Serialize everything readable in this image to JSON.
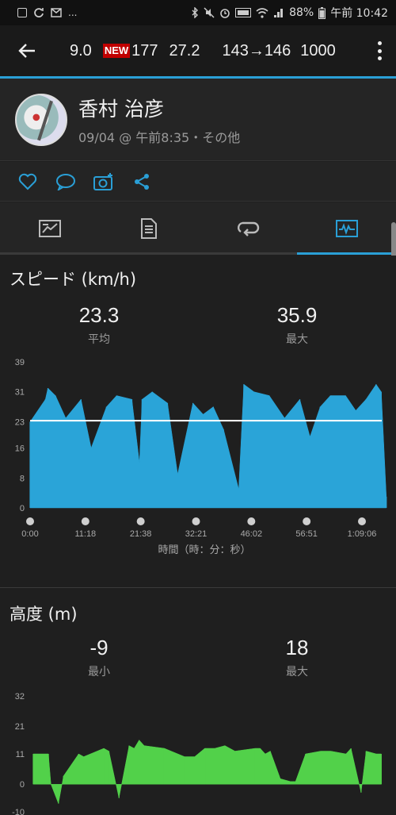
{
  "status_bar": {
    "battery": "88%",
    "time": "午前 10:42",
    "more": "..."
  },
  "app_bar": {
    "summary": {
      "v1": "9.0",
      "badge": "NEW",
      "v2": "177",
      "v3": "27.2",
      "v4": "143→146",
      "v5": "1000"
    }
  },
  "profile": {
    "name": "香村 治彦",
    "subtitle": "09/04 @ 午前8:35・その他"
  },
  "actions": [
    "like-icon",
    "comment-icon",
    "add-photo-icon",
    "share-icon"
  ],
  "tabs": [
    {
      "icon": "overview-icon",
      "active": false
    },
    {
      "icon": "details-icon",
      "active": false
    },
    {
      "icon": "laps-icon",
      "active": false
    },
    {
      "icon": "charts-icon",
      "active": true
    }
  ],
  "speed_section": {
    "title": "スピード (km/h)",
    "avg_value": "23.3",
    "avg_label": "平均",
    "max_value": "35.9",
    "max_label": "最大",
    "xlabel": "時間（時：分：秒）"
  },
  "altitude_section": {
    "title": "高度 (m)",
    "min_value": "-9",
    "min_label": "最小",
    "max_value": "18",
    "max_label": "最大"
  },
  "colors": {
    "accent": "#2a9fd6",
    "speed_fill": "#2aa4d8",
    "altitude_fill": "#52d14a"
  },
  "chart_data": [
    {
      "type": "area",
      "yticks": [
        "39",
        "31",
        "23",
        "16",
        "8",
        "0"
      ],
      "ytick_values": [
        39,
        31,
        23,
        16,
        8,
        0
      ],
      "xticks": [
        "0:00",
        "11:18",
        "21:38",
        "32:21",
        "46:02",
        "56:51",
        "1:09:06"
      ],
      "x_minutes": [
        0,
        3,
        3.5,
        5,
        7,
        10,
        12,
        15,
        17,
        20,
        21.5,
        22,
        24,
        27,
        29,
        32,
        34,
        36,
        38,
        41,
        42,
        44,
        47,
        50,
        53,
        55,
        57,
        59,
        62,
        64,
        66,
        68,
        69,
        70
      ],
      "values": [
        23,
        29,
        32,
        30,
        24,
        29,
        16,
        27,
        30,
        29,
        12,
        29,
        31,
        28,
        9,
        28,
        25,
        27,
        21,
        5,
        33,
        31,
        30,
        24,
        29,
        19,
        27,
        30,
        30,
        26,
        29,
        33,
        31,
        3
      ],
      "ylim": [
        0,
        39
      ],
      "xlim": [
        0,
        69.1
      ],
      "reference_line": 23.3,
      "grid": false
    },
    {
      "type": "area",
      "yticks": [
        "32",
        "21",
        "11",
        "0",
        "-10"
      ],
      "ytick_values": [
        32,
        21,
        11,
        0,
        -10
      ],
      "x_minutes": [
        0,
        3,
        3.5,
        5,
        6,
        9,
        10,
        14,
        15,
        17,
        19,
        20,
        21,
        22,
        26,
        30,
        32,
        34,
        36,
        38,
        40,
        44,
        45,
        46,
        47,
        49,
        51,
        52,
        54,
        57,
        59,
        62,
        63,
        65,
        66,
        68,
        69
      ],
      "values": [
        11,
        11,
        0,
        -7,
        3,
        11,
        10,
        13,
        12,
        -5,
        14,
        13,
        16,
        14,
        13,
        10,
        10,
        13,
        13,
        14,
        12,
        13,
        13,
        11,
        12,
        2,
        1,
        1,
        11,
        12,
        12,
        11,
        13,
        -3,
        12,
        11,
        11
      ],
      "ylim": [
        -10,
        32
      ],
      "xlim": [
        0,
        69.1
      ],
      "grid": false
    }
  ]
}
